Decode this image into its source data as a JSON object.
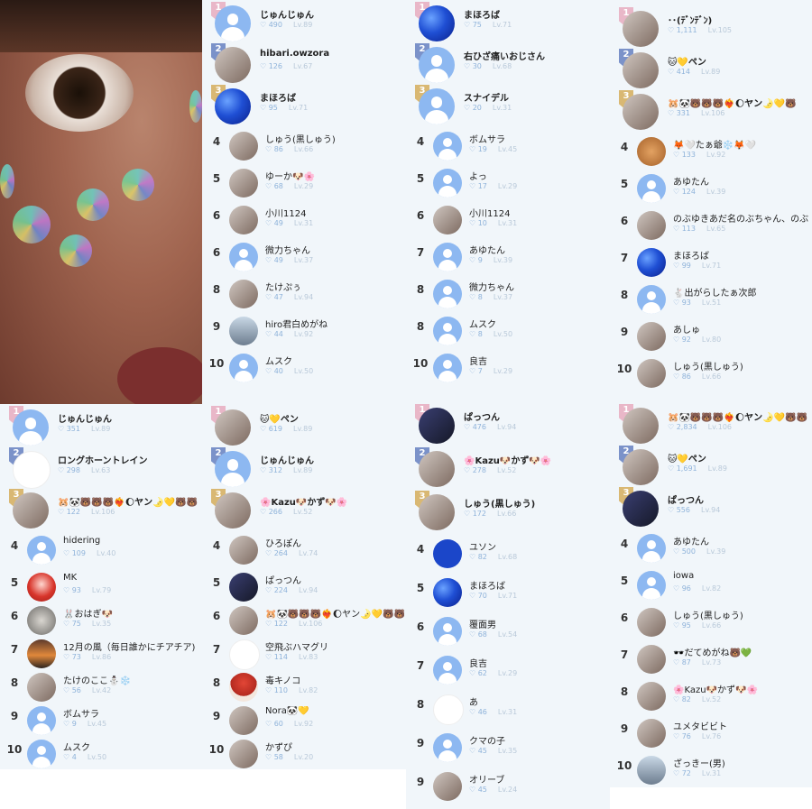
{
  "stat_icon": "heart-icon",
  "panels": [
    {
      "rows": [
        {
          "rank": "1",
          "name": "じゅんじゅん",
          "likes": "490",
          "level": "Lv.89",
          "avatar": "default"
        },
        {
          "rank": "2",
          "name": "hibari.owzora",
          "likes": "126",
          "level": "Lv.67",
          "avatar": "photo"
        },
        {
          "rank": "3",
          "name": "まほろば",
          "likes": "95",
          "level": "Lv.71",
          "avatar": "blue"
        },
        {
          "rank": "4",
          "name": "しゅう(黒しゅう)",
          "likes": "86",
          "level": "Lv.66",
          "avatar": "photo"
        },
        {
          "rank": "5",
          "name": "ゆーか🐶🌸",
          "likes": "68",
          "level": "Lv.29",
          "avatar": "photo"
        },
        {
          "rank": "6",
          "name": "小川1124",
          "likes": "49",
          "level": "Lv.31",
          "avatar": "photo"
        },
        {
          "rank": "6",
          "name": "微力ちゃん",
          "likes": "49",
          "level": "Lv.37",
          "avatar": "default"
        },
        {
          "rank": "8",
          "name": "たけぷぅ",
          "likes": "47",
          "level": "Lv.94",
          "avatar": "photo"
        },
        {
          "rank": "9",
          "name": "hiro君白めがね",
          "likes": "44",
          "level": "Lv.92",
          "avatar": "car"
        },
        {
          "rank": "10",
          "name": "ムスク",
          "likes": "40",
          "level": "Lv.50",
          "avatar": "default"
        }
      ]
    },
    {
      "rows": [
        {
          "rank": "1",
          "name": "まほろば",
          "likes": "75",
          "level": "Lv.71",
          "avatar": "blue"
        },
        {
          "rank": "2",
          "name": "右ひざ痛いおじさん",
          "likes": "30",
          "level": "Lv.68",
          "avatar": "default"
        },
        {
          "rank": "3",
          "name": "スナイデル",
          "likes": "20",
          "level": "Lv.31",
          "avatar": "default"
        },
        {
          "rank": "4",
          "name": "ボムサラ",
          "likes": "19",
          "level": "Lv.45",
          "avatar": "default"
        },
        {
          "rank": "5",
          "name": "よっ",
          "likes": "17",
          "level": "Lv.29",
          "avatar": "default"
        },
        {
          "rank": "6",
          "name": "小川1124",
          "likes": "10",
          "level": "Lv.31",
          "avatar": "photo"
        },
        {
          "rank": "7",
          "name": "あゆたん",
          "likes": "9",
          "level": "Lv.39",
          "avatar": "default"
        },
        {
          "rank": "8",
          "name": "微力ちゃん",
          "likes": "8",
          "level": "Lv.37",
          "avatar": "default"
        },
        {
          "rank": "8",
          "name": "ムスク",
          "likes": "8",
          "level": "Lv.50",
          "avatar": "default"
        },
        {
          "rank": "10",
          "name": "良吉",
          "likes": "7",
          "level": "Lv.29",
          "avatar": "default"
        }
      ]
    },
    {
      "rows": [
        {
          "rank": "1",
          "name": "･･(ﾃﾞﾝﾃﾞﾝ)",
          "likes": "1,111",
          "level": "Lv.105",
          "avatar": "photo"
        },
        {
          "rank": "2",
          "name": "🐱💛ペン",
          "likes": "414",
          "level": "Lv.89",
          "avatar": "photo"
        },
        {
          "rank": "3",
          "name": "🐹🐼🐻🐻🐻❤️‍🔥🌔ヤン🌛💛🐻",
          "likes": "331",
          "level": "Lv.106",
          "avatar": "photo"
        },
        {
          "rank": "4",
          "name": "🦊🤍たぁ爺❄️🦊🤍",
          "likes": "133",
          "level": "Lv.92",
          "avatar": "dog"
        },
        {
          "rank": "5",
          "name": "あゆたん",
          "likes": "124",
          "level": "Lv.39",
          "avatar": "default"
        },
        {
          "rank": "6",
          "name": "のぶゆきあだ名のぶちゃん、のぶ",
          "likes": "113",
          "level": "Lv.65",
          "avatar": "photo"
        },
        {
          "rank": "7",
          "name": "まほろば",
          "likes": "99",
          "level": "Lv.71",
          "avatar": "blue"
        },
        {
          "rank": "8",
          "name": "🐇出がらしたぁ次郎",
          "likes": "93",
          "level": "Lv.51",
          "avatar": "default"
        },
        {
          "rank": "9",
          "name": "あしゅ",
          "likes": "92",
          "level": "Lv.80",
          "avatar": "photo"
        },
        {
          "rank": "10",
          "name": "しゅう(黒しゅう)",
          "likes": "86",
          "level": "Lv.66",
          "avatar": "photo"
        }
      ]
    },
    {
      "rows": [
        {
          "rank": "1",
          "name": "じゅんじゅん",
          "likes": "351",
          "level": "Lv.89",
          "avatar": "default"
        },
        {
          "rank": "2",
          "name": "ロングホーントレイン",
          "likes": "298",
          "level": "Lv.63",
          "avatar": "white"
        },
        {
          "rank": "3",
          "name": "🐹🐼🐻🐻🐻❤️‍🔥🌔ヤン🌛💛🐻🐻",
          "likes": "122",
          "level": "Lv.106",
          "avatar": "photo"
        },
        {
          "rank": "4",
          "name": "hidering",
          "likes": "109",
          "level": "Lv.40",
          "avatar": "default"
        },
        {
          "rank": "5",
          "name": "MK",
          "likes": "93",
          "level": "Lv.79",
          "avatar": "red"
        },
        {
          "rank": "6",
          "name": "🐰おはぎ🐶",
          "likes": "75",
          "level": "Lv.35",
          "avatar": "cat"
        },
        {
          "rank": "7",
          "name": "12月の風（毎日誰かにチアチア)",
          "likes": "73",
          "level": "Lv.86",
          "avatar": "sunset"
        },
        {
          "rank": "8",
          "name": "たけのここ⛄❄️",
          "likes": "56",
          "level": "Lv.42",
          "avatar": "photo"
        },
        {
          "rank": "9",
          "name": "ボムサラ",
          "likes": "9",
          "level": "Lv.45",
          "avatar": "default"
        },
        {
          "rank": "10",
          "name": "ムスク",
          "likes": "4",
          "level": "Lv.50",
          "avatar": "default"
        }
      ]
    },
    {
      "rows": [
        {
          "rank": "1",
          "name": "🐱💛ペン",
          "likes": "619",
          "level": "Lv.89",
          "avatar": "photo"
        },
        {
          "rank": "2",
          "name": "じゅんじゅん",
          "likes": "312",
          "level": "Lv.89",
          "avatar": "default"
        },
        {
          "rank": "3",
          "name": "🌸Kazu🐶かず🐶🌸",
          "likes": "266",
          "level": "Lv.52",
          "avatar": "photo"
        },
        {
          "rank": "4",
          "name": "ひろぽん",
          "likes": "264",
          "level": "Lv.74",
          "avatar": "photo"
        },
        {
          "rank": "5",
          "name": "ぱっつん",
          "likes": "224",
          "level": "Lv.94",
          "avatar": "dark"
        },
        {
          "rank": "6",
          "name": "🐹🐼🐻🐻🐻❤️‍🔥🌔ヤン🌛💛🐻🐻",
          "likes": "122",
          "level": "Lv.106",
          "avatar": "photo"
        },
        {
          "rank": "7",
          "name": "空飛ぶハマグリ",
          "likes": "114",
          "level": "Lv.83",
          "avatar": "white"
        },
        {
          "rank": "8",
          "name": "毒キノコ",
          "likes": "110",
          "level": "Lv.82",
          "avatar": "mush"
        },
        {
          "rank": "9",
          "name": "Nora🐼💛",
          "likes": "60",
          "level": "Lv.92",
          "avatar": "photo"
        },
        {
          "rank": "10",
          "name": "かずぴ",
          "likes": "58",
          "level": "Lv.20",
          "avatar": "photo"
        }
      ]
    },
    {
      "rows": [
        {
          "rank": "1",
          "name": "ぱっつん",
          "likes": "476",
          "level": "Lv.94",
          "avatar": "dark"
        },
        {
          "rank": "2",
          "name": "🌸Kazu🐶かず🐶🌸",
          "likes": "278",
          "level": "Lv.52",
          "avatar": "photo"
        },
        {
          "rank": "3",
          "name": "しゅう(黒しゅう)",
          "likes": "172",
          "level": "Lv.66",
          "avatar": "photo"
        },
        {
          "rank": "4",
          "name": "ユソン",
          "likes": "82",
          "level": "Lv.68",
          "avatar": "star"
        },
        {
          "rank": "5",
          "name": "まほろば",
          "likes": "70",
          "level": "Lv.71",
          "avatar": "blue"
        },
        {
          "rank": "6",
          "name": "覆面男",
          "likes": "68",
          "level": "Lv.54",
          "avatar": "default"
        },
        {
          "rank": "7",
          "name": "良吉",
          "likes": "62",
          "level": "Lv.29",
          "avatar": "default"
        },
        {
          "rank": "8",
          "name": "あ",
          "likes": "46",
          "level": "Lv.31",
          "avatar": "white"
        },
        {
          "rank": "9",
          "name": "クマの子",
          "likes": "45",
          "level": "Lv.35",
          "avatar": "default"
        },
        {
          "rank": "9",
          "name": "オリーブ",
          "likes": "45",
          "level": "Lv.24",
          "avatar": "photo"
        }
      ]
    },
    {
      "rows": [
        {
          "rank": "1",
          "name": "🐹🐼🐻🐻🐻❤️‍🔥🌔ヤン🌛💛🐻🐻",
          "likes": "2,834",
          "level": "Lv.106",
          "avatar": "photo"
        },
        {
          "rank": "2",
          "name": "🐱💛ペン",
          "likes": "1,691",
          "level": "Lv.89",
          "avatar": "photo"
        },
        {
          "rank": "3",
          "name": "ぱっつん",
          "likes": "556",
          "level": "Lv.94",
          "avatar": "dark"
        },
        {
          "rank": "4",
          "name": "あゆたん",
          "likes": "500",
          "level": "Lv.39",
          "avatar": "default"
        },
        {
          "rank": "5",
          "name": "iowa",
          "likes": "96",
          "level": "Lv.82",
          "avatar": "default"
        },
        {
          "rank": "6",
          "name": "しゅう(黒しゅう)",
          "likes": "95",
          "level": "Lv.66",
          "avatar": "photo"
        },
        {
          "rank": "7",
          "name": "🕶️だてめがね🐻💚",
          "likes": "87",
          "level": "Lv.73",
          "avatar": "photo"
        },
        {
          "rank": "8",
          "name": "🌸Kazu🐶かず🐶🌸",
          "likes": "82",
          "level": "Lv.52",
          "avatar": "photo"
        },
        {
          "rank": "9",
          "name": "ユメタビビト",
          "likes": "76",
          "level": "Lv.76",
          "avatar": "photo"
        },
        {
          "rank": "10",
          "name": "ざっきー(男)",
          "likes": "72",
          "level": "Lv.31",
          "avatar": "car"
        }
      ]
    }
  ]
}
